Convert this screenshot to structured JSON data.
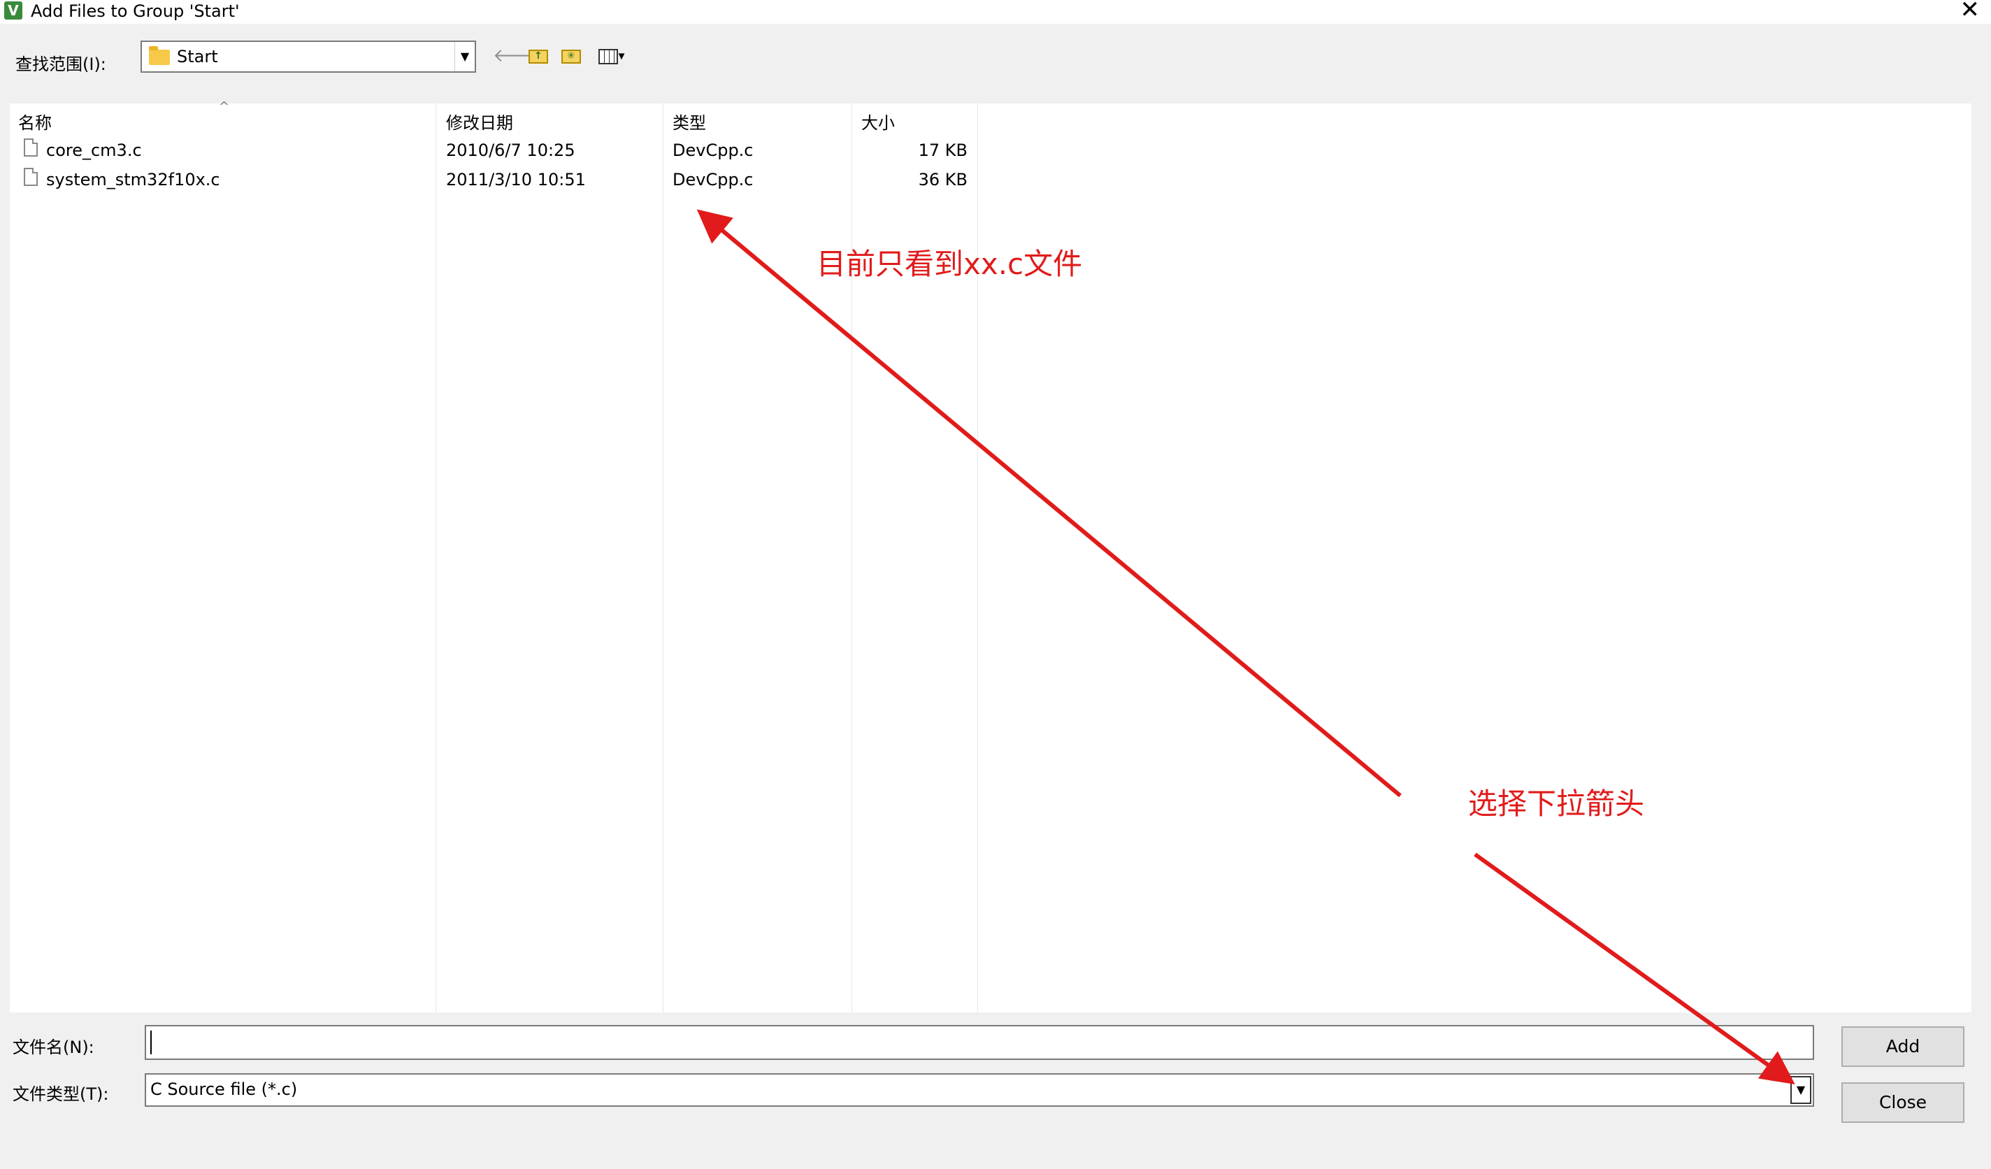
{
  "window": {
    "title": "Add Files to Group 'Start'",
    "app_icon": "V",
    "close_glyph": "✕"
  },
  "toolbar": {
    "lookin_label": "查找范围(I):",
    "lookin_value": "Start",
    "back_glyph": "🡐",
    "view_menu_glyph": "▾"
  },
  "list": {
    "columns": {
      "name": "名称",
      "date": "修改日期",
      "type": "类型",
      "size": "大小"
    },
    "files": [
      {
        "name": "core_cm3.c",
        "date": "2010/6/7 10:25",
        "type": "DevCpp.c",
        "size": "17 KB"
      },
      {
        "name": "system_stm32f10x.c",
        "date": "2011/3/10 10:51",
        "type": "DevCpp.c",
        "size": "36 KB"
      }
    ]
  },
  "footer": {
    "filename_label": "文件名(N):",
    "filename_value": "",
    "filetype_label": "文件类型(T):",
    "filetype_value": "C Source file (*.c)",
    "add_label": "Add",
    "close_label": "Close"
  },
  "annotations": {
    "note1": "目前只看到xx.c文件",
    "note2": "选择下拉箭头",
    "color": "#e11b1b"
  }
}
